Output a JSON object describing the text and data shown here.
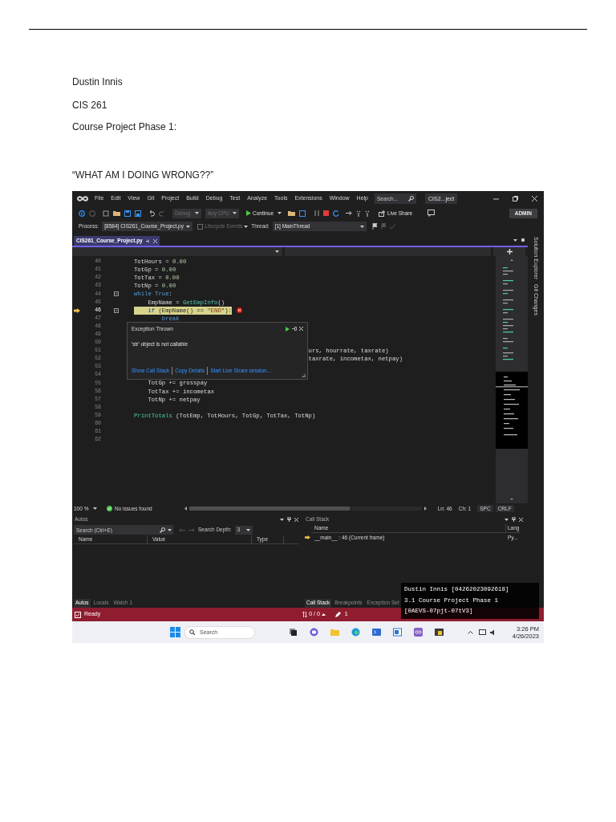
{
  "document": {
    "author": "Dustin Innis",
    "course": "CIS 261",
    "assignment": "Course Project Phase 1:",
    "question": "“WHAT AM I DOING WRONG??”"
  },
  "screenshot": {
    "menu": [
      "File",
      "Edit",
      "View",
      "Git",
      "Project",
      "Build",
      "Debug",
      "Test",
      "Analyze",
      "Tools",
      "Extensions",
      "Window",
      "Help"
    ],
    "search_placeholder": "Search...",
    "title": "CIS2...ject",
    "toolbar": {
      "configuration": {
        "value": "Debug",
        "disabled": true
      },
      "platform": {
        "value": "Any CPU",
        "disabled": true
      },
      "continue": "Continue",
      "live_share": "Live Share",
      "account": "ADMIN"
    },
    "debug_location": {
      "process_label": "Process:",
      "process": "[8584] CIS261_Course_Project.py",
      "lifecycle": {
        "label": "Lifecycle Events",
        "disabled": true
      },
      "thread_label": "Thread:",
      "thread": "[1] MainThread"
    },
    "editor_tabs": [
      {
        "label": "CIS261_Course_Project.py",
        "selected": true
      }
    ],
    "code_lines": [
      {
        "number": "40",
        "current": false,
        "error": false,
        "fold": false,
        "tokens": [
          {
            "text": "TotHours",
            "kind": "var"
          },
          {
            "text": " = ",
            "kind": "op"
          },
          {
            "text": "0.00",
            "kind": "num"
          }
        ]
      },
      {
        "number": "41",
        "current": false,
        "error": false,
        "fold": false,
        "tokens": [
          {
            "text": "TotGp",
            "kind": "var"
          },
          {
            "text": " = ",
            "kind": "op"
          },
          {
            "text": "0.00",
            "kind": "num"
          }
        ]
      },
      {
        "number": "42",
        "current": false,
        "error": false,
        "fold": false,
        "tokens": [
          {
            "text": "TotTax",
            "kind": "var"
          },
          {
            "text": " = ",
            "kind": "op"
          },
          {
            "text": "0.00",
            "kind": "num"
          }
        ]
      },
      {
        "number": "43",
        "current": false,
        "error": false,
        "fold": false,
        "tokens": [
          {
            "text": "TotNp",
            "kind": "var"
          },
          {
            "text": " = ",
            "kind": "op"
          },
          {
            "text": "0.00",
            "kind": "num"
          }
        ]
      },
      {
        "number": "44",
        "current": false,
        "error": false,
        "fold": true,
        "tokens": [
          {
            "text": "while True",
            "kind": "kw"
          },
          {
            "text": ":",
            "kind": "op"
          }
        ]
      },
      {
        "number": "45",
        "current": false,
        "error": false,
        "fold": false,
        "tokens": [
          {
            "text": "    EmpName",
            "kind": "var"
          },
          {
            "text": " = ",
            "kind": "op"
          },
          {
            "text": "GetEmpInfo",
            "kind": "fn"
          },
          {
            "text": "()",
            "kind": "op"
          }
        ]
      },
      {
        "number": "46",
        "current": true,
        "error": true,
        "fold": true,
        "tokens": [
          {
            "text": "    if",
            "kind": "kw"
          },
          {
            "text": " (",
            "kind": "op"
          },
          {
            "text": "EmpName",
            "kind": "var"
          },
          {
            "text": "() == ",
            "kind": "op"
          },
          {
            "text": "\"END\"",
            "kind": "str"
          },
          {
            "text": "):",
            "kind": "op"
          }
        ]
      },
      {
        "number": "47",
        "current": false,
        "error": false,
        "fold": false,
        "tokens": [
          {
            "text": "        break",
            "kind": "kw"
          }
        ]
      },
      {
        "number": "48",
        "current": false,
        "error": false,
        "fold": false
      },
      {
        "number": "49",
        "current": false,
        "error": false,
        "fold": false
      },
      {
        "number": "50",
        "current": false,
        "error": false,
        "fold": false
      },
      {
        "number": "51",
        "current": false,
        "error": false,
        "fold": false,
        "tokens": [
          {
            "text": "                                                  urs, hourrate, taxrate)",
            "kind": "var"
          }
        ]
      },
      {
        "number": "52",
        "current": false,
        "error": false,
        "fold": false,
        "tokens": [
          {
            "text": "                                                  taxrate, incometax, netpay)",
            "kind": "var"
          }
        ]
      },
      {
        "number": "53",
        "current": false,
        "error": false,
        "fold": false
      },
      {
        "number": "54",
        "current": false,
        "error": false,
        "fold": false
      },
      {
        "number": "55",
        "current": false,
        "error": false,
        "fold": false,
        "tokens": [
          {
            "text": "    TotGp",
            "kind": "var"
          },
          {
            "text": " += ",
            "kind": "op"
          },
          {
            "text": "grosspay",
            "kind": "var"
          }
        ]
      },
      {
        "number": "56",
        "current": false,
        "error": false,
        "fold": false,
        "tokens": [
          {
            "text": "    TotTax",
            "kind": "var"
          },
          {
            "text": " += ",
            "kind": "op"
          },
          {
            "text": "incometax",
            "kind": "var"
          }
        ]
      },
      {
        "number": "57",
        "current": false,
        "error": false,
        "fold": false,
        "tokens": [
          {
            "text": "    TotNp",
            "kind": "var"
          },
          {
            "text": " += ",
            "kind": "op"
          },
          {
            "text": "netpay",
            "kind": "var"
          }
        ]
      },
      {
        "number": "58",
        "current": false,
        "error": false,
        "fold": false
      },
      {
        "number": "59",
        "current": false,
        "error": false,
        "fold": false,
        "tokens": [
          {
            "text": "PrintTotals",
            "kind": "fn"
          },
          {
            "text": " (TotEmp, TotHours, TotGp, TotTax, TotNp)",
            "kind": "var"
          }
        ]
      },
      {
        "number": "60",
        "current": false,
        "error": false,
        "fold": false
      },
      {
        "number": "61",
        "current": false,
        "error": false,
        "fold": false
      },
      {
        "number": "62",
        "current": false,
        "error": false,
        "fold": false
      }
    ],
    "exception": {
      "title": "Exception Thrown",
      "message": "'str' object is not callable",
      "links": [
        "Show Call Stack",
        "Copy Details",
        "Start Live Share session..."
      ]
    },
    "side_tabs": [
      "Solution Explorer",
      "Git Changes"
    ],
    "editor_status": {
      "zoom": "100 %",
      "issues": "No issues found",
      "line": "Ln: 46",
      "column": "Ch: 1",
      "whitespace": "SPC",
      "line_ending": "CRLF"
    },
    "autos": {
      "title": "Autos",
      "search_placeholder": "Search (Ctrl+E)",
      "depth_label": "Search Depth:",
      "depth": "3",
      "columns": [
        "Name",
        "Value",
        "Type"
      ],
      "tabs": [
        {
          "label": "Autos",
          "selected": true
        },
        {
          "label": "Locals",
          "selected": false
        },
        {
          "label": "Watch 1",
          "selected": false
        }
      ]
    },
    "call_stack": {
      "title": "Call Stack",
      "columns": [
        "Name",
        "Lang"
      ],
      "rows": [
        {
          "name": "__main__ : 46 (Current frame)",
          "language": "Py...",
          "current": true
        }
      ],
      "tabs": [
        {
          "label": "Call Stack",
          "selected": true
        },
        {
          "label": "Breakpoints",
          "selected": false
        },
        {
          "label": "Exception Set",
          "selected": false
        }
      ]
    },
    "status_bar": {
      "text": "Ready",
      "changes": "0 / 0",
      "edits": "1"
    },
    "taskbar": {
      "search_placeholder": "Search",
      "time": "3:26 PM",
      "date": "4/26/2023"
    },
    "overlay": [
      "Dustin Innis [04262023092618]",
      "3.1 Course Project Phase 1",
      "[0AEVS-07pjt-07tV3]"
    ]
  }
}
